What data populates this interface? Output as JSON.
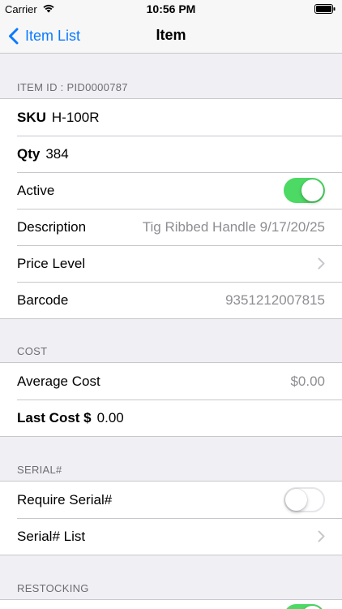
{
  "status_bar": {
    "carrier": "Carrier",
    "time": "10:56 PM",
    "wifi_icon": "wifi-icon",
    "battery_icon": "battery-icon"
  },
  "nav": {
    "back_label": "Item List",
    "title": "Item",
    "back_icon": "chevron-left-icon",
    "tint_color": "#0a7aff"
  },
  "item_section": {
    "header": "ITEM ID : PID0000787",
    "sku_label": "SKU",
    "sku_value": "H-100R",
    "qty_label": "Qty",
    "qty_value": "384",
    "active_label": "Active",
    "active_on": true,
    "description_label": "Description",
    "description_value": "Tig Ribbed Handle 9/17/20/25",
    "price_level_label": "Price Level",
    "barcode_label": "Barcode",
    "barcode_value": "9351212007815"
  },
  "cost_section": {
    "header": "COST",
    "average_cost_label": "Average Cost",
    "average_cost_value": "$0.00",
    "last_cost_label": "Last Cost $",
    "last_cost_value": "0.00"
  },
  "serial_section": {
    "header": "SERIAL#",
    "require_serial_label": "Require Serial#",
    "require_serial_on": false,
    "serial_list_label": "Serial# List"
  },
  "restocking_section": {
    "header": "RESTOCKING",
    "toggle_on": true
  },
  "colors": {
    "switch_on": "#4cd964",
    "secondary_text": "#8e8e93",
    "section_header": "#6d6d72",
    "background": "#efeff4"
  }
}
